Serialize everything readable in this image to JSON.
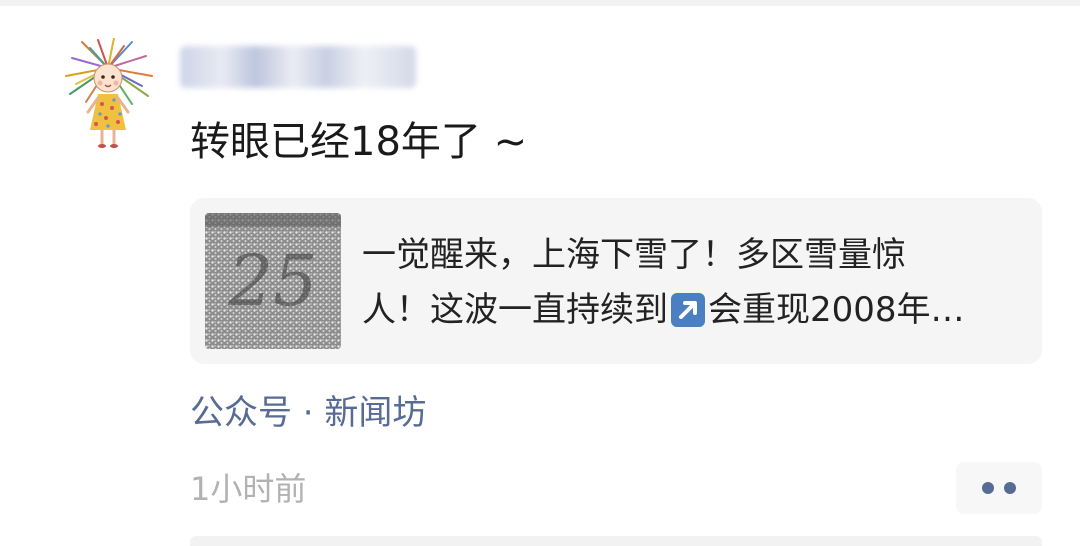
{
  "post": {
    "username": "",
    "text": "转眼已经18年了 ~",
    "article": {
      "title_line1": "一觉醒来，上海下雪了！多区雪量惊",
      "title_line2_prefix": "人！这波一直持续到",
      "title_line2_suffix": "会重现2008年…",
      "thumbnail_text": "25",
      "arrow_icon": "up-right-arrow-icon"
    },
    "source": "公众号 · 新闻坊",
    "timestamp": "1小时前",
    "more_icon": "more-dots-icon"
  },
  "colors": {
    "link": "#576b95",
    "timestamp": "#b2b2b2",
    "card_bg": "#f5f5f5",
    "arrow_badge": "#4a7fc1"
  }
}
